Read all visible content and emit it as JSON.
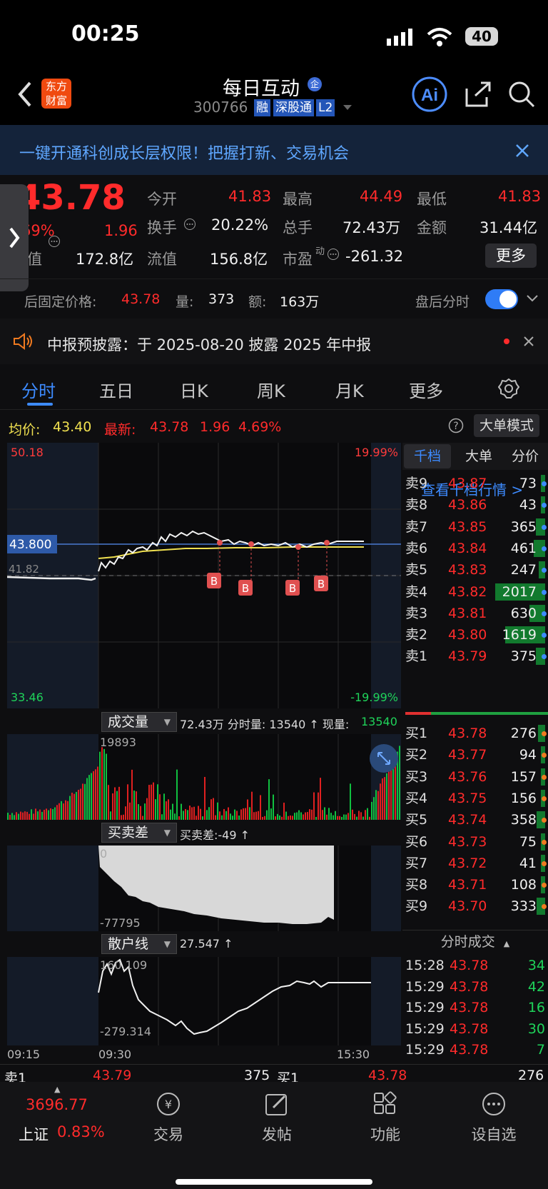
{
  "status_bar": {
    "time": "00:25",
    "battery": "40"
  },
  "header": {
    "title": "每日互动",
    "code": "300766",
    "tags": [
      "融",
      "深股通",
      "L2"
    ],
    "badge": "企",
    "logo": "东方财富"
  },
  "promo": {
    "text": "一键开通科创成长层权限！把握打新、交易机会"
  },
  "quote": {
    "price": "43.78",
    "pct": "69%",
    "change": "1.96",
    "row1": [
      {
        "l": "今开",
        "v": "41.83"
      },
      {
        "l": "最高",
        "v": "44.49"
      },
      {
        "l": "最低",
        "v": "41.83"
      }
    ],
    "row2": [
      {
        "l": "换手",
        "v": "20.22%"
      },
      {
        "l": "总手",
        "v": "72.43万"
      },
      {
        "l": "金额",
        "v": "31.44亿"
      }
    ],
    "row3": [
      {
        "l": "值",
        "v": "172.8亿"
      },
      {
        "l": "流值",
        "v": "156.8亿"
      },
      {
        "l": "市盈",
        "sup": "动",
        "v": "-261.32"
      }
    ],
    "more": "更多",
    "after": {
      "label": "后固定价格:",
      "price": "43.78",
      "vol_label": "量:",
      "vol": "373",
      "amt_label": "额:",
      "amt": "163万",
      "toggle_label": "盘后分时",
      "toggle_on": true
    }
  },
  "notice": {
    "text": "中报预披露：于 2025-08-20 披露 2025 年中报"
  },
  "tabs": [
    "分时",
    "五日",
    "日K",
    "周K",
    "月K",
    "更多"
  ],
  "info": {
    "avg_label": "均价:",
    "avg": "43.40",
    "last_label": "最新:",
    "last": "43.78",
    "chg": "1.96",
    "pct": "4.69%",
    "mode": "大单模式"
  },
  "chart_data": {
    "type": "line",
    "price_axis": {
      "max": "50.18",
      "min": "33.46",
      "pct_max": "19.99%",
      "pct_min": "-19.99%",
      "prev_close": "41.82",
      "current": "43.800"
    },
    "marker_label": "B",
    "markers": 4,
    "time_labels": [
      "09:15",
      "09:30",
      "15:30"
    ],
    "volume": {
      "title": "成交量",
      "summary": "72.43万 分时量: 13540 ↑ 现量: ",
      "now": "13540",
      "peak": "19893"
    },
    "diff": {
      "title": "买卖差",
      "summary": "买卖差:-49 ↑",
      "top": "0",
      "bottom": "-77795"
    },
    "retail": {
      "title": "散户线",
      "summary": "27.547 ↑",
      "top": "160.109",
      "bottom": "-279.314"
    }
  },
  "book": {
    "tabs": [
      "千档",
      "大单",
      "分价"
    ],
    "link": "查看千档行情 >",
    "asks": [
      [
        "卖9",
        "43.87",
        "73"
      ],
      [
        "卖8",
        "43.86",
        "43"
      ],
      [
        "卖7",
        "43.85",
        "365"
      ],
      [
        "卖6",
        "43.84",
        "461"
      ],
      [
        "卖5",
        "43.83",
        "247"
      ],
      [
        "卖4",
        "43.82",
        "2017"
      ],
      [
        "卖3",
        "43.81",
        "630"
      ],
      [
        "卖2",
        "43.80",
        "1619"
      ],
      [
        "卖1",
        "43.79",
        "375"
      ]
    ],
    "bids": [
      [
        "买1",
        "43.78",
        "276"
      ],
      [
        "买2",
        "43.77",
        "94"
      ],
      [
        "买3",
        "43.76",
        "157"
      ],
      [
        "买4",
        "43.75",
        "156"
      ],
      [
        "买5",
        "43.74",
        "358"
      ],
      [
        "买6",
        "43.73",
        "75"
      ],
      [
        "买7",
        "43.72",
        "41"
      ],
      [
        "买8",
        "43.71",
        "108"
      ],
      [
        "买9",
        "43.70",
        "333"
      ]
    ],
    "trades_title": "分时成交",
    "trades": [
      [
        "15:28",
        "43.78",
        "34"
      ],
      [
        "15:29",
        "43.78",
        "42"
      ],
      [
        "15:29",
        "43.78",
        "16"
      ],
      [
        "15:29",
        "43.78",
        "30"
      ],
      [
        "15:29",
        "43.78",
        "7"
      ]
    ]
  },
  "footer_quote": {
    "ask_label": "卖1",
    "ask_price": "43.79",
    "ask_vol": "375",
    "bid_label": "买1",
    "bid_price": "43.78",
    "bid_vol": "276"
  },
  "bottom_nav": {
    "index_value": "3696.77",
    "index_name": "上证",
    "index_pct": "0.83%",
    "items": [
      "交易",
      "发帖",
      "功能",
      "设自选"
    ]
  }
}
